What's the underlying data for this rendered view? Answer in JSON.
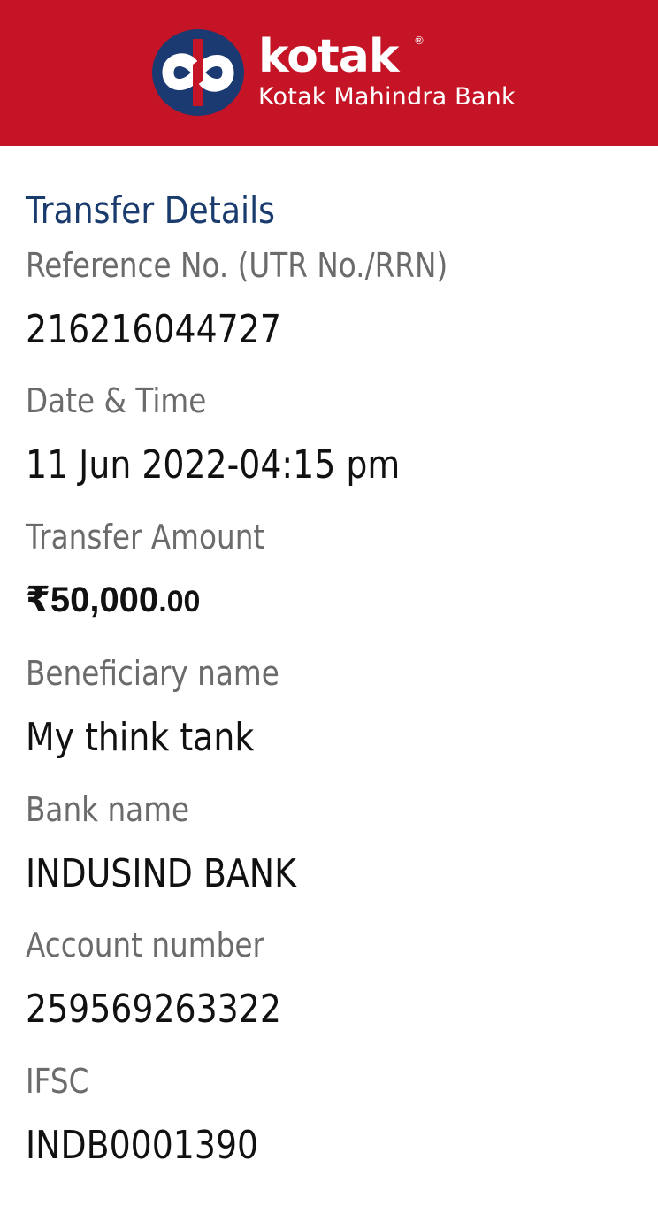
{
  "header": {
    "brand": "kotak",
    "registered_mark": "®",
    "bank_name": "Kotak Mahindra Bank",
    "logo_icon": "kotak-infinity-logo-icon",
    "background_color": "#c41426"
  },
  "transfer": {
    "title": "Transfer Details",
    "title_color": "#1a3b6d",
    "fields": [
      {
        "label": "Reference No. (UTR No./RRN)",
        "value": "216216044727"
      },
      {
        "label": "Date & Time",
        "value": "11 Jun 2022-04:15 pm"
      },
      {
        "label": "Transfer Amount",
        "value": "₹50,000",
        "decimals": ".00"
      },
      {
        "label": "Beneficiary name",
        "value": "My think tank"
      },
      {
        "label": "Bank name",
        "value": "INDUSIND BANK"
      },
      {
        "label": "Account number",
        "value": "259569263322"
      },
      {
        "label": "IFSC",
        "value": "INDB0001390"
      }
    ]
  }
}
